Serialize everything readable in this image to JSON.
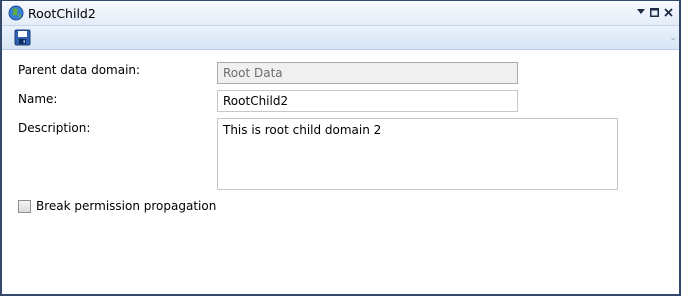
{
  "window": {
    "title": "RootChild2",
    "icon": "globe-icon",
    "controls": [
      "pin-icon",
      "maximize-icon",
      "close-icon"
    ]
  },
  "toolbar": {
    "save_icon": "floppy-disk-icon"
  },
  "form": {
    "parent_label": "Parent data domain:",
    "parent_value": "Root Data",
    "name_label": "Name:",
    "name_value": "RootChild2",
    "description_label": "Description:",
    "description_value": "This is root child domain 2",
    "break_permission_label": "Break permission propagation",
    "break_permission_checked": false
  }
}
